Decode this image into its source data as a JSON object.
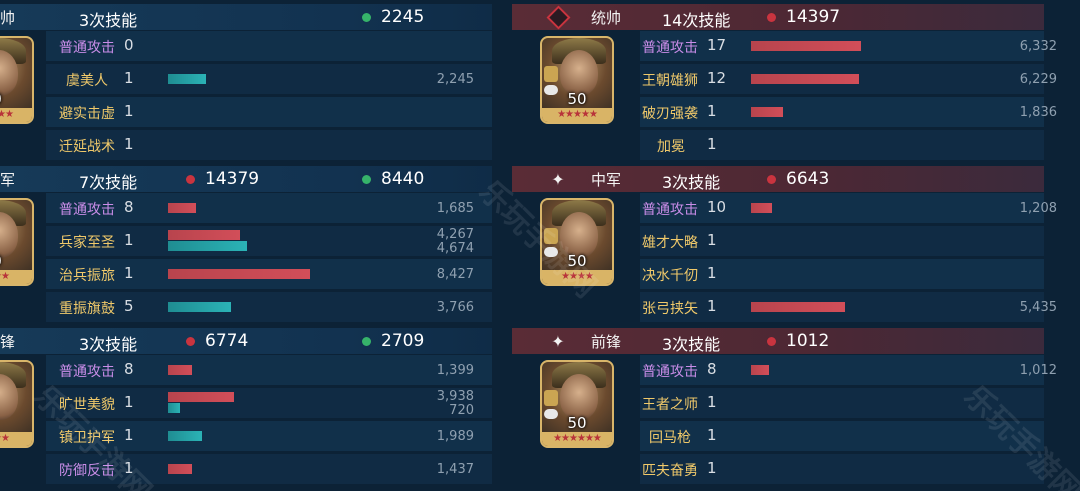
{
  "left": [
    {
      "rank": "帅",
      "skill_count": "3次技能",
      "stats": [
        {
          "color": "green",
          "value": "2245"
        }
      ],
      "level": "0",
      "stars": "★★★★",
      "skills": [
        {
          "name": "普通攻击",
          "purple": true,
          "times": "0",
          "bars": [],
          "dmg": []
        },
        {
          "name": "虞美人",
          "purple": false,
          "times": "1",
          "bars": [
            {
              "color": "teal",
              "frac": 0.267
            }
          ],
          "dmg": [
            "2,245"
          ]
        },
        {
          "name": "避实击虚",
          "purple": false,
          "times": "1",
          "bars": [],
          "dmg": []
        },
        {
          "name": "迁延战术",
          "purple": false,
          "times": "1",
          "bars": [],
          "dmg": []
        }
      ]
    },
    {
      "rank": "军",
      "skill_count": "7次技能",
      "stats": [
        {
          "color": "red",
          "value": "14379"
        },
        {
          "color": "green",
          "value": "8440"
        }
      ],
      "level": "0",
      "stars": "★★★",
      "skills": [
        {
          "name": "普通攻击",
          "purple": true,
          "times": "8",
          "bars": [
            {
              "color": "red",
              "frac": 0.2
            }
          ],
          "dmg": [
            "1,685"
          ]
        },
        {
          "name": "兵家至圣",
          "purple": false,
          "times": "1",
          "bars": [
            {
              "color": "red",
              "frac": 0.506
            },
            {
              "color": "teal",
              "frac": 0.555
            }
          ],
          "dmg": [
            "4,267",
            "4,674"
          ]
        },
        {
          "name": "治兵振旅",
          "purple": false,
          "times": "1",
          "bars": [
            {
              "color": "red",
              "frac": 1.0
            }
          ],
          "dmg": [
            "8,427"
          ]
        },
        {
          "name": "重振旗鼓",
          "purple": false,
          "times": "5",
          "bars": [
            {
              "color": "teal",
              "frac": 0.447
            }
          ],
          "dmg": [
            "3,766"
          ]
        }
      ]
    },
    {
      "rank": "锋",
      "skill_count": "3次技能",
      "stats": [
        {
          "color": "red",
          "value": "6774"
        },
        {
          "color": "green",
          "value": "2709"
        }
      ],
      "level": "",
      "stars": "★★★",
      "skills": [
        {
          "name": "普通攻击",
          "purple": true,
          "times": "8",
          "bars": [
            {
              "color": "red",
              "frac": 0.166
            }
          ],
          "dmg": [
            "1,399"
          ]
        },
        {
          "name": "旷世美貌",
          "purple": false,
          "times": "1",
          "bars": [
            {
              "color": "red",
              "frac": 0.467
            },
            {
              "color": "teal",
              "frac": 0.085
            }
          ],
          "dmg": [
            "3,938",
            "720"
          ]
        },
        {
          "name": "镇卫护军",
          "purple": false,
          "times": "1",
          "bars": [
            {
              "color": "teal",
              "frac": 0.236
            }
          ],
          "dmg": [
            "1,989"
          ]
        },
        {
          "name": "防御反击",
          "purple": true,
          "times": "1",
          "bars": [
            {
              "color": "red",
              "frac": 0.171
            }
          ],
          "dmg": [
            "1,437"
          ]
        }
      ]
    }
  ],
  "right": [
    {
      "rank": "统帅",
      "icon": "diamond",
      "skill_count": "14次技能",
      "stats": [
        {
          "color": "red",
          "value": "14397"
        }
      ],
      "level": "50",
      "stars": "★★★★★",
      "skills": [
        {
          "name": "普通攻击",
          "purple": true,
          "times": "17",
          "bars": [
            {
              "color": "red",
              "frac": 0.75
            }
          ],
          "dmg": [
            "6,332"
          ]
        },
        {
          "name": "王朝雄狮",
          "purple": false,
          "times": "12",
          "bars": [
            {
              "color": "red",
              "frac": 0.738
            }
          ],
          "dmg": [
            "6,229"
          ]
        },
        {
          "name": "破刃强袭",
          "purple": false,
          "times": "1",
          "bars": [
            {
              "color": "red",
              "frac": 0.218
            }
          ],
          "dmg": [
            "1,836"
          ]
        },
        {
          "name": "加冕",
          "purple": false,
          "times": "1",
          "bars": [],
          "dmg": []
        }
      ]
    },
    {
      "rank": "中军",
      "icon": "star",
      "skill_count": "3次技能",
      "stats": [
        {
          "color": "red",
          "value": "6643"
        }
      ],
      "level": "50",
      "stars": "★★★★",
      "skills": [
        {
          "name": "普通攻击",
          "purple": true,
          "times": "10",
          "bars": [
            {
              "color": "red",
              "frac": 0.143
            }
          ],
          "dmg": [
            "1,208"
          ]
        },
        {
          "name": "雄才大略",
          "purple": false,
          "times": "1",
          "bars": [],
          "dmg": []
        },
        {
          "name": "决水千仞",
          "purple": false,
          "times": "1",
          "bars": [],
          "dmg": []
        },
        {
          "name": "张弓挟矢",
          "purple": false,
          "times": "1",
          "bars": [
            {
              "color": "red",
              "frac": 0.645
            }
          ],
          "dmg": [
            "5,435"
          ]
        }
      ]
    },
    {
      "rank": "前锋",
      "icon": "star",
      "skill_count": "3次技能",
      "stats": [
        {
          "color": "red",
          "value": "1012"
        }
      ],
      "level": "50",
      "stars": "★★★★★★",
      "skills": [
        {
          "name": "普通攻击",
          "purple": true,
          "times": "8",
          "bars": [
            {
              "color": "red",
              "frac": 0.12
            }
          ],
          "dmg": [
            "1,012"
          ]
        },
        {
          "name": "王者之师",
          "purple": false,
          "times": "1",
          "bars": [],
          "dmg": []
        },
        {
          "name": "回马枪",
          "purple": false,
          "times": "1",
          "bars": [],
          "dmg": []
        },
        {
          "name": "匹夫奋勇",
          "purple": false,
          "times": "1",
          "bars": [],
          "dmg": []
        }
      ]
    }
  ],
  "watermark": "乐玩手游网"
}
